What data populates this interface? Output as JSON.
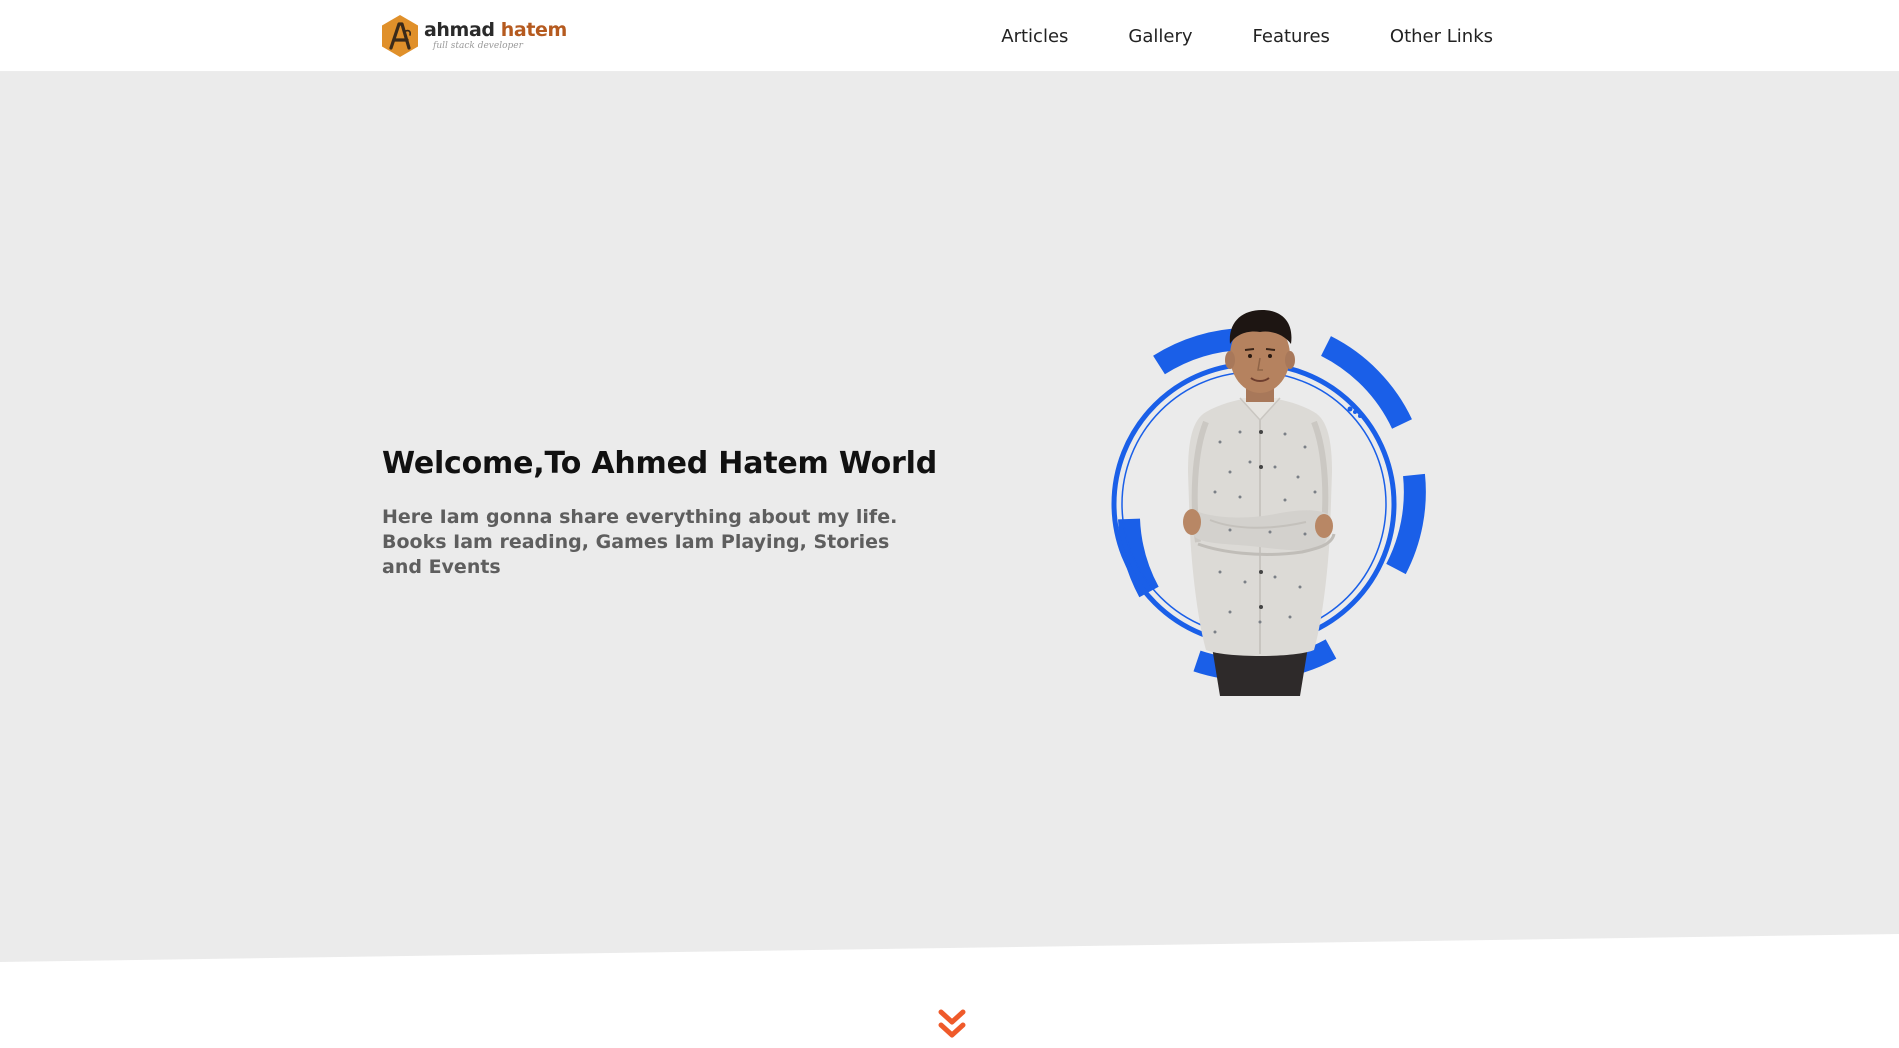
{
  "header": {
    "logo": {
      "icon": "hexagon-letter-a-logo",
      "name_first": "ahmad",
      "name_second": "hatem",
      "tagline": "full stack developer"
    },
    "nav": [
      {
        "label": "Articles"
      },
      {
        "label": "Gallery"
      },
      {
        "label": "Features"
      },
      {
        "label": "Other Links"
      }
    ]
  },
  "hero": {
    "title": "Welcome,To Ahmed Hatem World",
    "description": "Here Iam gonna share everything about my life. Books Iam reading, Games Iam Playing, Stories and Events",
    "image": "portrait-man-arms-crossed"
  },
  "scroll": {
    "icon": "double-chevron-down-icon"
  },
  "colors": {
    "hero_bg": "#ebebeb",
    "ring_blue": "#1a5fe8",
    "logo_orange": "#e0902a",
    "scroll_orange": "#ef5a2a"
  }
}
